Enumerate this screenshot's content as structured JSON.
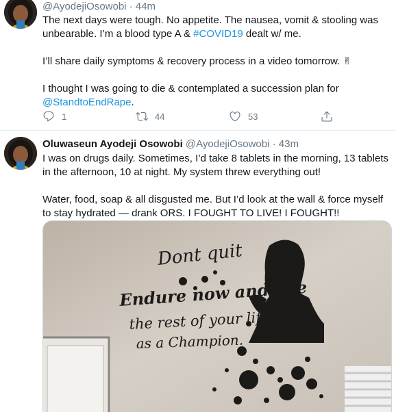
{
  "tweets": [
    {
      "author": {
        "name": "",
        "handle": "@AyodejiOsowobi"
      },
      "time": "44m",
      "paragraphs": [
        {
          "parts": [
            {
              "text": "The next days were tough. No appetite. The nausea, vomit & stooling was unbearable. I’m a blood type A & ",
              "link": false
            },
            {
              "text": "#COVID19",
              "link": true
            },
            {
              "text": " dealt w/ me.",
              "link": false
            }
          ]
        },
        {
          "parts": [
            {
              "text": "I’ll share daily symptoms & recovery process in a video tomorrow. ✌",
              "link": false
            }
          ]
        },
        {
          "parts": [
            {
              "text": "I thought I was going to die & contemplated a succession plan for ",
              "link": false
            },
            {
              "text": "@StandtoEndRape",
              "link": true
            },
            {
              "text": ".",
              "link": false
            }
          ]
        }
      ],
      "actions": {
        "replies": "1",
        "retweets": "44",
        "likes": "53"
      }
    },
    {
      "author": {
        "name": "Oluwaseun Ayodeji Osowobi",
        "handle": "@AyodejiOsowobi"
      },
      "time": "43m",
      "paragraphs": [
        {
          "parts": [
            {
              "text": "I was on drugs daily. Sometimes, I’d take 8 tablets in the morning, 13 tablets in the afternoon, 10 at night. My system threw everything out!",
              "link": false
            }
          ]
        },
        {
          "parts": [
            {
              "text": "Water, food, soap & all disgusted me. But I’d look at the wall & force myself to stay hydrated — drank ORS. I FOUGHT TO LIVE! I FOUGHT!!",
              "link": false
            }
          ]
        }
      ],
      "media": {
        "wall_text": [
          "Dont quit",
          "Endure now and live",
          "the rest of your life",
          "as a Champion."
        ]
      }
    }
  ],
  "separator": "·",
  "icons": {
    "reply": "reply-icon",
    "retweet": "retweet-icon",
    "like": "heart-icon",
    "share": "share-icon"
  },
  "colors": {
    "link": "#1b95e0",
    "meta": "#657786",
    "text": "#14171a"
  }
}
